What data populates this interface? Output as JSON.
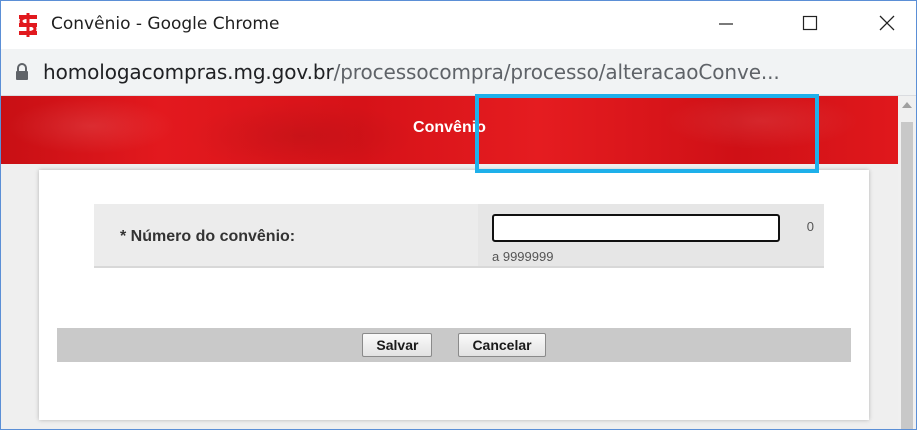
{
  "window": {
    "title": "Convênio - Google Chrome",
    "icon": "red-dollar-app-icon",
    "controls": {
      "minimize": "minimize-icon",
      "maximize": "maximize-icon",
      "close": "close-icon"
    }
  },
  "address_bar": {
    "lock_icon": "lock-icon",
    "host": "homologacompras.mg.gov.br",
    "path": "/processocompra/processo/alteracaoConve..."
  },
  "header": {
    "title": "Convênio"
  },
  "form": {
    "field_label": "* Número do convênio:",
    "input_value": "",
    "min_value": "0",
    "range_text": "a 9999999"
  },
  "buttons": {
    "save": "Salvar",
    "cancel": "Cancelar"
  },
  "colors": {
    "header_red": "#e0181c",
    "highlight": "#1eb0ea",
    "window_border": "#5b8fd6"
  }
}
